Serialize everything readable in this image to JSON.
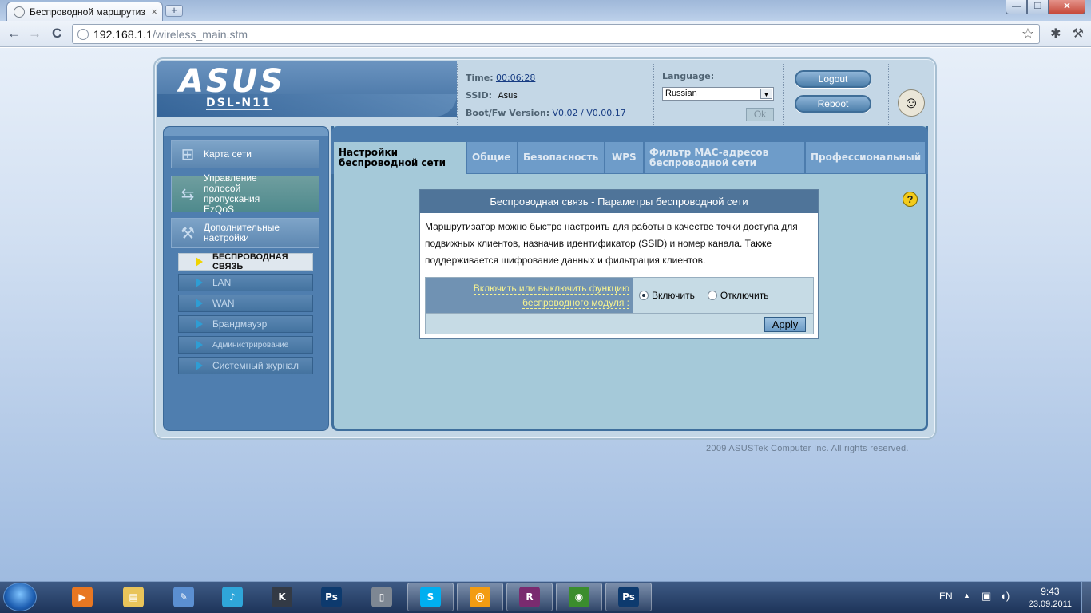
{
  "browser": {
    "tab_title": "Беспроводной маршрутиз",
    "tab_close": "×",
    "new_tab": "+",
    "url_host": "192.168.1.1",
    "url_path": "/wireless_main.stm",
    "star": "☆",
    "back": "←",
    "forward": "→",
    "reload": "C",
    "win_min": "—",
    "win_max": "❐",
    "win_close": "✕"
  },
  "header": {
    "logo": "ASUS",
    "model": "DSL-N11",
    "time_label": "Time:",
    "time_value": "00:06:28",
    "ssid_label": "SSID:",
    "ssid_value": "Asus",
    "fw_label": "Boot/Fw Version:",
    "fw_value": "V0.02 / V0.00.17",
    "language_label": "Language:",
    "language_value": "Russian",
    "ok_label": "Ok",
    "logout_label": "Logout",
    "reboot_label": "Reboot"
  },
  "sidebar": {
    "items": [
      {
        "label": "Карта сети",
        "icon": "network-map-icon"
      },
      {
        "label": "Управление полосой пропускания EzQoS",
        "icon": "ezqos-icon"
      },
      {
        "label": "Дополнительные настройки",
        "icon": "tools-icon"
      }
    ],
    "subitems": [
      {
        "label": "БЕСПРОВОДНАЯ СВЯЗЬ",
        "active": true
      },
      {
        "label": "LAN"
      },
      {
        "label": "WAN"
      },
      {
        "label": "Брандмауэр"
      },
      {
        "label": "Администрирование"
      },
      {
        "label": "Системный журнал"
      }
    ]
  },
  "tabs": [
    {
      "label": "Настройки беспроводной сети",
      "active": true
    },
    {
      "label": "Общие"
    },
    {
      "label": "Безопасность"
    },
    {
      "label": "WPS"
    },
    {
      "label": "Фильтр MAC-адресов беспроводной сети"
    },
    {
      "label": "Профессиональный"
    }
  ],
  "content": {
    "help": "?",
    "box_title": "Беспроводная связь - Параметры беспроводной сети",
    "description": "Маршрутизатор можно быстро настроить для работы в качестве точки доступа для подвижных клиентов, назначив идентификатор (SSID) и номер канала. Также поддерживается шифрование данных и фильтрация клиентов.",
    "field_label_1": "Включить или выключить функцию",
    "field_label_2": "беспроводного модуля :",
    "option_on": "Включить",
    "option_off": "Отключить",
    "selected": "on",
    "apply_label": "Apply"
  },
  "footer": {
    "copyright": "2009 ASUSTek Computer Inc. All rights reserved."
  },
  "taskbar": {
    "apps": [
      {
        "name": "media-player",
        "color": "#e87722",
        "open": false
      },
      {
        "name": "file-explorer",
        "color": "#e9c45a",
        "open": false
      },
      {
        "name": "painter",
        "color": "#5b8fd1",
        "open": false
      },
      {
        "name": "music-app",
        "color": "#2fa6d9",
        "open": false
      },
      {
        "name": "kmplayer",
        "color": "#333a45",
        "open": false
      },
      {
        "name": "photoshop",
        "color": "#0d3a6e",
        "open": false
      },
      {
        "name": "pda-app",
        "color": "#7e8793",
        "open": false
      },
      {
        "name": "skype",
        "color": "#00aff0",
        "open": true
      },
      {
        "name": "mail-agent",
        "color": "#f39c12",
        "open": true
      },
      {
        "name": "winrar",
        "color": "#7a2b6f",
        "open": true
      },
      {
        "name": "chrome",
        "color": "#3b8d2d",
        "open": true
      },
      {
        "name": "photoshop",
        "color": "#0d3a6e",
        "open": true
      }
    ],
    "lang": "EN",
    "time": "9:43",
    "date": "23.09.2011"
  }
}
